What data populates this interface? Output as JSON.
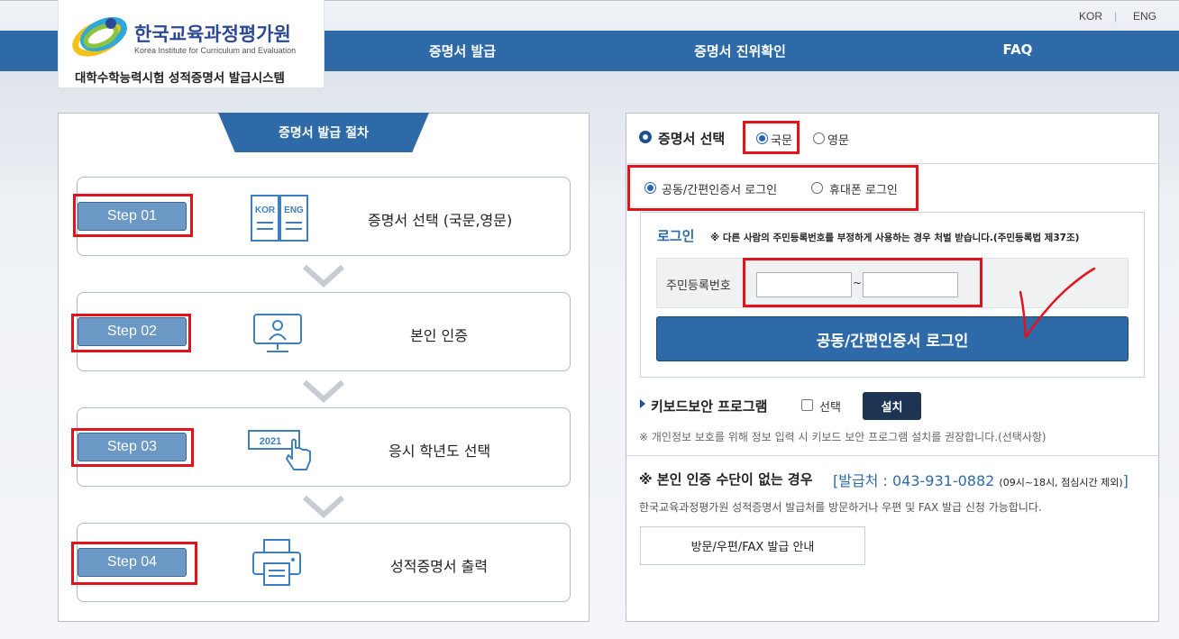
{
  "header": {
    "lang_kor": "KOR",
    "lang_sep": "|",
    "lang_eng": "ENG",
    "logo_title": "한국교육과정평가원",
    "logo_sub": "Korea Institute for Curriculum and Evaluation",
    "logo_system": "대학수학능력시험 성적증명서 발급시스템"
  },
  "nav": {
    "items": [
      "증명서 발급",
      "증명서 진위확인",
      "FAQ"
    ]
  },
  "procedure": {
    "title": "증명서 발급 절차",
    "steps": [
      {
        "step": "Step 01",
        "label": "증명서 선택 (국문,영문)",
        "icon": "kor-eng-book-icon",
        "icon_text_1": "KOR",
        "icon_text_2": "ENG"
      },
      {
        "step": "Step 02",
        "label": "본인 인증",
        "icon": "monitor-user-icon"
      },
      {
        "step": "Step 03",
        "label": "응시 학년도 선택",
        "icon": "year-click-icon",
        "icon_text": "2021"
      },
      {
        "step": "Step 04",
        "label": "성적증명서 출력",
        "icon": "printer-icon"
      }
    ]
  },
  "certificate": {
    "title": "증명서 선택",
    "options": [
      "국문",
      "영문"
    ],
    "selected": "국문"
  },
  "login_method": {
    "options": [
      "공동/간편인증서 로그인",
      "휴대폰 로그인"
    ],
    "selected": "공동/간편인증서 로그인"
  },
  "login": {
    "title": "로그인",
    "note": "※ 다른 사람의 주민등록번호를 부정하게 사용하는 경우 처벌 받습니다.(주민등록법 제37조)",
    "id_label": "주민등록번호",
    "id_first": "",
    "id_second": "",
    "tilde": "~",
    "button": "공동/간편인증서 로그인"
  },
  "keyboard": {
    "title": "키보드보안 프로그램",
    "checkbox_label": "선택",
    "install_button": "설치",
    "note": "※ 개인정보 보호를 위해 정보 입력 시 키보드 보안 프로그램 설치를 권장합니다.(선택사항)"
  },
  "no_means": {
    "title": "※ 본인 인증 수단이 없는 경우",
    "phone_main": "[발급처 : 043-931-0882",
    "phone_small": "(09시~18시, 점심시간 제외)",
    "phone_end": "]",
    "note": "한국교육과정평가원 성적증명서 발급처를 방문하거나 우편 및 FAX 발급 신청 가능합니다.",
    "button": "방문/우편/FAX 발급 안내"
  },
  "colors": {
    "primary": "#2f6aa8",
    "step_button": "#6b98c4",
    "highlight_box": "#e3121b",
    "install_button": "#1d3453"
  }
}
